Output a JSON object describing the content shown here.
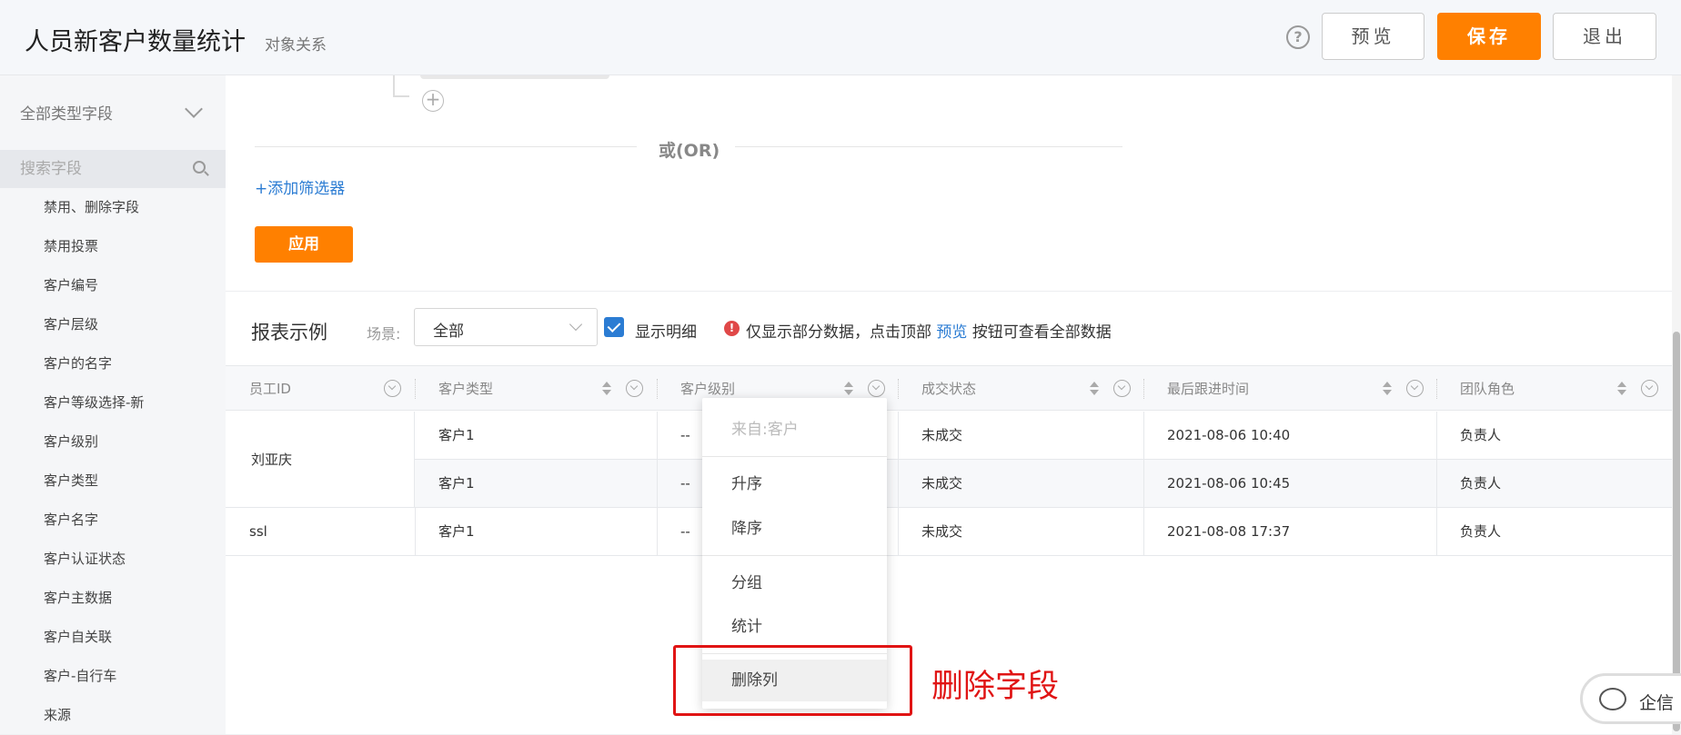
{
  "header": {
    "title": "人员新客户数量统计",
    "subtitle": "对象关系",
    "help_symbol": "?",
    "preview_label": "预览",
    "save_label": "保存",
    "exit_label": "退出"
  },
  "sidebar": {
    "field_type_label": "全部类型字段",
    "search_placeholder": "搜索字段",
    "fields": [
      "禁用、删除字段",
      "禁用投票",
      "客户编号",
      "客户层级",
      "客户的名字",
      "客户等级选择-新",
      "客户级别",
      "客户类型",
      "客户名字",
      "客户认证状态",
      "客户主数据",
      "客户自关联",
      "客户-自行车",
      "来源"
    ]
  },
  "filter": {
    "or_label": "或(OR)",
    "add_filter_label": "+添加筛选器",
    "apply_label": "应用",
    "plus_symbol": "+"
  },
  "report": {
    "title": "报表示例",
    "scene_label": "场景:",
    "scene_value": "全部",
    "show_detail_label": "显示明细",
    "show_detail_checked": true,
    "notice_prefix": "仅显示部分数据，点击顶部",
    "notice_link": "预览",
    "notice_suffix": "按钮可查看全部数据",
    "warn_symbol": "!"
  },
  "table": {
    "columns": [
      "员工ID",
      "客户类型",
      "客户级别",
      "成交状态",
      "最后跟进时间",
      "团队角色"
    ],
    "rows": [
      {
        "employee": "刘亚庆",
        "type": "客户1",
        "level": "--",
        "status": "未成交",
        "time": "2021-08-06 10:40",
        "role": "负责人"
      },
      {
        "employee": "",
        "type": "客户1",
        "level": "--",
        "status": "未成交",
        "time": "2021-08-06 10:45",
        "role": "负责人"
      },
      {
        "employee": "ssl",
        "type": "客户1",
        "level": "--",
        "status": "未成交",
        "time": "2021-08-08 17:37",
        "role": "负责人"
      }
    ]
  },
  "context_menu": {
    "source_label": "来自:客户",
    "asc_label": "升序",
    "desc_label": "降序",
    "group_label": "分组",
    "stat_label": "统计",
    "delete_label": "删除列"
  },
  "annotation": {
    "text": "删除字段",
    "color": "#e01414"
  },
  "chat": {
    "label": "企信"
  },
  "colors": {
    "accent": "#ff8000",
    "link": "#2b7cd3"
  }
}
